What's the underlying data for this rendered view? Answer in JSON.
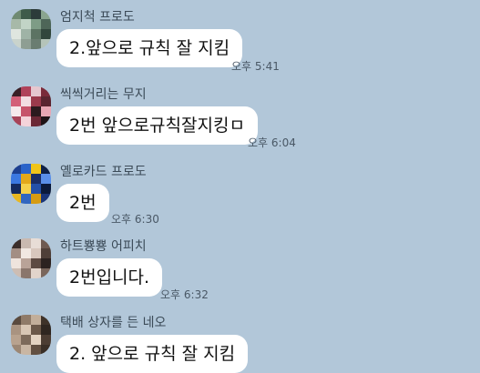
{
  "messages": [
    {
      "sender": "엄지척 프로도",
      "text": "2.앞으로 규칙 잘 지킴",
      "time": "오후 5:41",
      "avatar_colors": [
        "#6f8a72",
        "#3f5b4a",
        "#2c3b3a",
        "#8aa58f",
        "#a7b9a8",
        "#c2d4c6",
        "#7e9c86",
        "#4e6658",
        "#dfe6df",
        "#9fb3a6",
        "#5c7363",
        "#31463c",
        "#c9d3cc",
        "#8e9e93",
        "#6a7d71",
        "#b5c4b9"
      ]
    },
    {
      "sender": "씩씩거리는 무지",
      "text": "2번 앞으로규칙잘지킹ㅁ",
      "time": "오후 6:04",
      "avatar_colors": [
        "#3a1f26",
        "#b0425a",
        "#e6c7cf",
        "#7a2b3a",
        "#d35f78",
        "#f2dde2",
        "#9b3a4c",
        "#5a2530",
        "#f6e9ec",
        "#c7546b",
        "#2b1a1e",
        "#e8a7b4",
        "#a74358",
        "#f4d3da",
        "#6b2836",
        "#1f1417"
      ]
    },
    {
      "sender": "옐로카드 프로도",
      "text": "2번",
      "time": "오후 6:30",
      "avatar_colors": [
        "#1d3f8f",
        "#2a63c9",
        "#f0c419",
        "#0f2147",
        "#3b78e0",
        "#e3a81a",
        "#1a2e66",
        "#5a8fe8",
        "#142a5e",
        "#f5d04a",
        "#2350a8",
        "#0b1a3a",
        "#e9b720",
        "#3166c0",
        "#d69b12",
        "#1a3578"
      ]
    },
    {
      "sender": "하트뿅뿅 어피치",
      "text": "2번입니다.",
      "time": "오후 6:32",
      "avatar_colors": [
        "#3b2e2a",
        "#c9b9b0",
        "#e8ddd6",
        "#6e5a51",
        "#a38e83",
        "#f1e8e2",
        "#d8c7bd",
        "#4f3f38",
        "#efe4dd",
        "#b9a398",
        "#5d4a42",
        "#2c2220",
        "#cdbdb3",
        "#8a766c",
        "#e2d4cb",
        "#7a665c"
      ]
    },
    {
      "sender": "택배 상자를 든 네오",
      "text": "2. 앞으로 규칙 잘 지킴",
      "time": "",
      "avatar_colors": [
        "#5a4a3e",
        "#8f7a68",
        "#c2ae9a",
        "#3e3229",
        "#a99380",
        "#d8c6b4",
        "#6b5849",
        "#2f2620",
        "#b8a28e",
        "#7d6a5a",
        "#e3d3c2",
        "#4c3d33",
        "#9c8774",
        "#c9b6a3",
        "#625042",
        "#3a2f27"
      ]
    }
  ]
}
